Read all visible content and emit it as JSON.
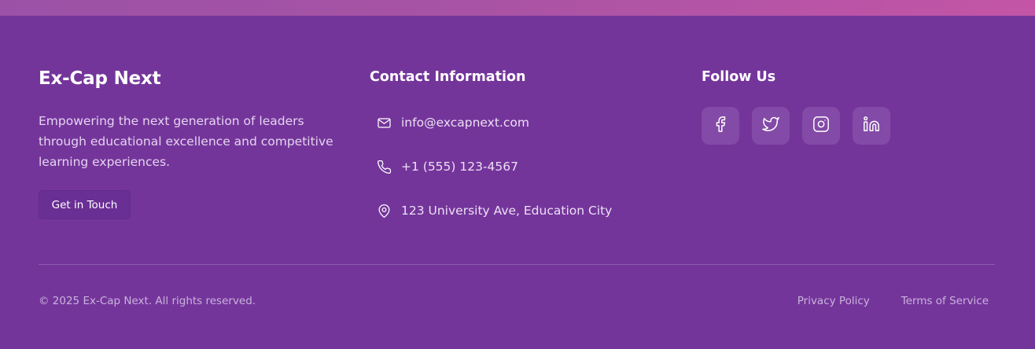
{
  "brand": {
    "title": "Ex-Cap Next",
    "description": "Empowering the next generation of leaders through educational excellence and competitive learning experiences.",
    "cta_label": "Get in Touch"
  },
  "contact": {
    "title": "Contact Information",
    "items": [
      {
        "icon": "mail-icon",
        "text": "info@excapnext.com"
      },
      {
        "icon": "phone-icon",
        "text": "+1 (555) 123-4567"
      },
      {
        "icon": "map-pin-icon",
        "text": "123 University Ave, Education City"
      }
    ]
  },
  "follow": {
    "title": "Follow Us",
    "networks": [
      {
        "icon": "facebook-icon"
      },
      {
        "icon": "twitter-icon"
      },
      {
        "icon": "instagram-icon"
      },
      {
        "icon": "linkedin-icon"
      }
    ]
  },
  "bottom": {
    "copyright": "© 2025 Ex-Cap Next. All rights reserved.",
    "links": [
      "Privacy Policy",
      "Terms of Service"
    ]
  },
  "colors": {
    "background": "#74359b",
    "accent_gradient_start": "#9b52a6",
    "accent_gradient_end": "#c455a6",
    "text_muted": "#c9b3dc"
  }
}
